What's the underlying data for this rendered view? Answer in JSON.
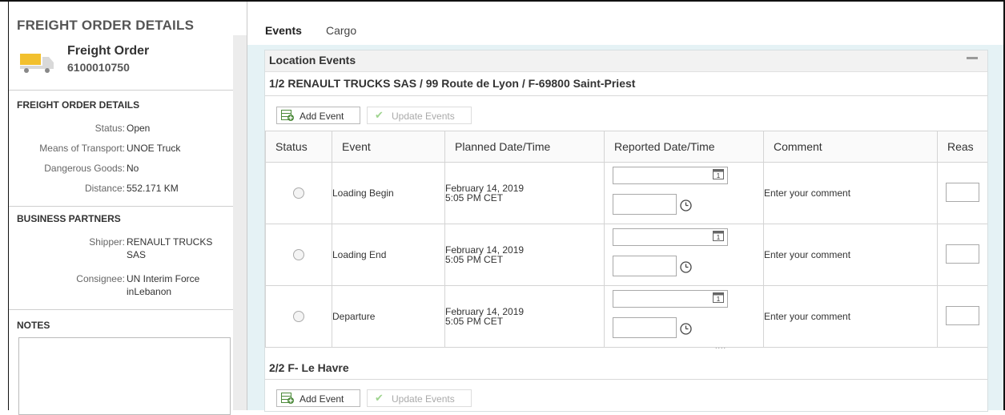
{
  "left_panel": {
    "header": "FREIGHT ORDER DETAILS",
    "order_title": "Freight Order",
    "order_number": "6100010750",
    "details_title": "FREIGHT ORDER DETAILS",
    "details": [
      {
        "label": "Status:",
        "value": "Open"
      },
      {
        "label": "Means of Transport:",
        "value": "UNOE Truck"
      },
      {
        "label": "Dangerous Goods:",
        "value": "No"
      },
      {
        "label": "Distance:",
        "value": "552.171 KM"
      }
    ],
    "partners_title": "BUSINESS PARTNERS",
    "partners": [
      {
        "label": "Shipper:",
        "value": "RENAULT TRUCKS SAS"
      },
      {
        "label": "Consignee:",
        "value": "UN Interim Force inLebanon"
      }
    ],
    "notes_title": "NOTES"
  },
  "tabs": [
    {
      "label": "Events",
      "active": true
    },
    {
      "label": "Cargo",
      "active": false
    }
  ],
  "location_events": {
    "title": "Location Events",
    "locations": [
      {
        "title": "1/2 RENAULT TRUCKS SAS / 99 Route de Lyon / F-69800 Saint-Priest"
      },
      {
        "title": "2/2 F- Le Havre"
      }
    ],
    "add_event_label": "Add Event",
    "update_events_label": "Update Events",
    "columns": [
      "Status",
      "Event",
      "Planned Date/Time",
      "Reported Date/Time",
      "Comment",
      "Reas"
    ],
    "rows": [
      {
        "event": "Loading Begin",
        "planned_date": "February 14, 2019",
        "planned_time": "5:05 PM CET",
        "comment_placeholder": "Enter your comment"
      },
      {
        "event": "Loading End",
        "planned_date": "February 14, 2019",
        "planned_time": "5:05 PM CET",
        "comment_placeholder": "Enter your comment"
      },
      {
        "event": "Departure",
        "planned_date": "February 14, 2019",
        "planned_time": "5:05 PM CET",
        "comment_placeholder": "Enter your comment"
      }
    ],
    "resize_indicator": "...."
  },
  "colors": {
    "content_background": "#e5f2f5",
    "truck_icon": "#f2c02e",
    "add_icon": "#4c8a3a",
    "check_disabled": "#9fd48f"
  }
}
